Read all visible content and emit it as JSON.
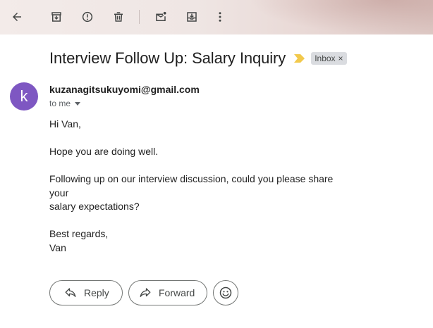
{
  "toolbar": {
    "icons": [
      "back-arrow-icon",
      "archive-icon",
      "report-spam-icon",
      "delete-icon",
      "mark-unread-icon",
      "move-to-inbox-icon",
      "more-vert-icon"
    ]
  },
  "email": {
    "subject": "Interview Follow Up: Salary Inquiry",
    "label_chip": "Inbox",
    "label_chip_close": "×",
    "sender_initial": "k",
    "sender": "kuzanagitsukuyomi@gmail.com",
    "recipient": "to me",
    "body": {
      "greeting": "Hi Van,",
      "line1": "Hope you are doing well.",
      "line2a": "Following up on our interview discussion, could you please share your",
      "line2b": "salary expectations?",
      "closing": "Best regards,",
      "signature": "Van"
    }
  },
  "actions": {
    "reply_label": "Reply",
    "forward_label": "Forward"
  },
  "colors": {
    "avatar": "#7e57c2",
    "importance_marker": "#f2c94c",
    "chip_bg": "#dadce0"
  }
}
